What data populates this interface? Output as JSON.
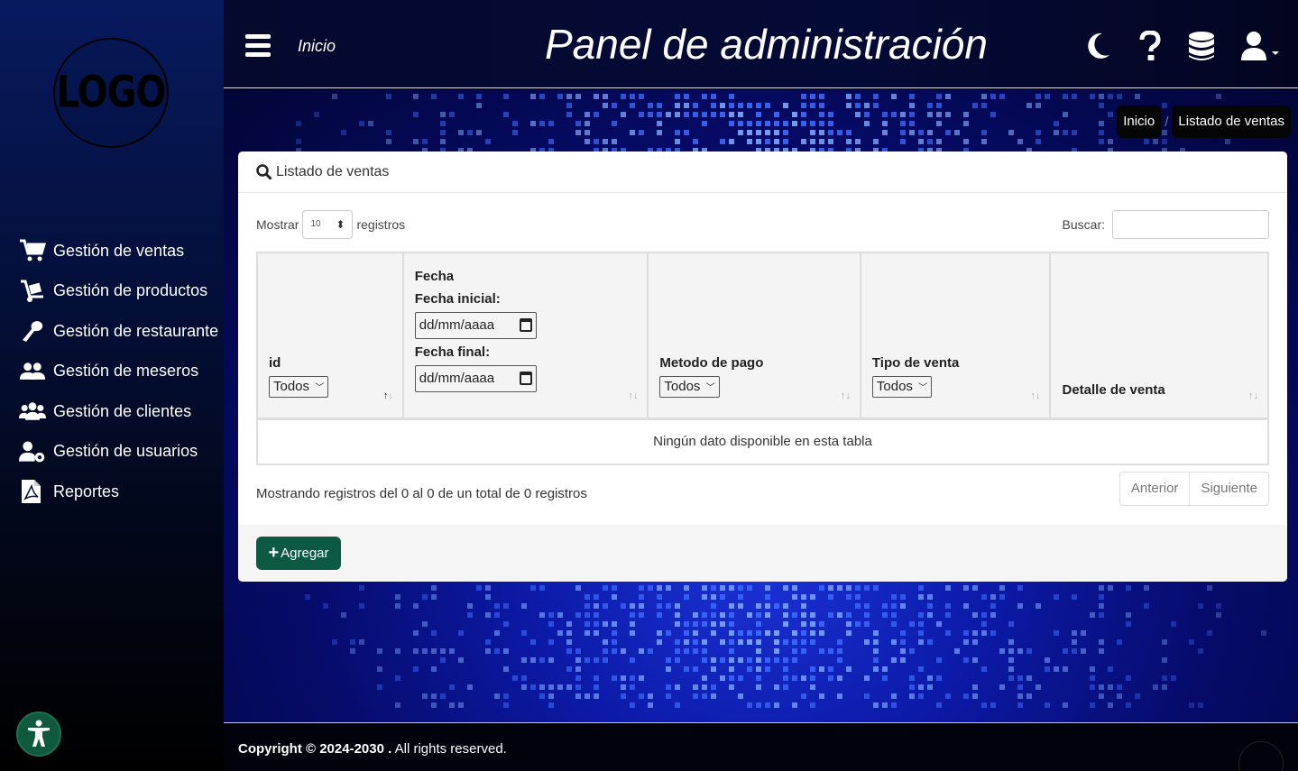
{
  "sidebar": {
    "logo_text": "LOGO",
    "items": [
      {
        "label": "Gestión de ventas",
        "icon": "cart-icon"
      },
      {
        "label": "Gestión de productos",
        "icon": "dolly-icon"
      },
      {
        "label": "Gestión de restaurante",
        "icon": "restaurant-icon"
      },
      {
        "label": "Gestión de meseros",
        "icon": "users-icon"
      },
      {
        "label": "Gestión de clientes",
        "icon": "users-group-icon"
      },
      {
        "label": "Gestión de usuarios",
        "icon": "user-gear-icon"
      },
      {
        "label": "Reportes",
        "icon": "pdf-file-icon"
      }
    ]
  },
  "header": {
    "home_link": "Inicio",
    "title": "Panel de administración",
    "icons": [
      "moon-icon",
      "question-icon",
      "database-icon",
      "user-icon"
    ]
  },
  "breadcrumb": {
    "home": "Inicio",
    "separator": "/",
    "current": "Listado de ventas"
  },
  "card": {
    "title": "Listado de ventas",
    "show_label": "Mostrar",
    "page_size": "10",
    "records_label": "registros",
    "search_label": "Buscar:",
    "search_value": "",
    "columns": {
      "id": {
        "label": "id",
        "filter": "Todos"
      },
      "fecha": {
        "label": "Fecha",
        "start_label": "Fecha inicial:",
        "start_placeholder": "dd/mm/aaaa",
        "end_label": "Fecha final:",
        "end_placeholder": "dd/mm/aaaa"
      },
      "metodo": {
        "label": "Metodo de pago",
        "filter": "Todos"
      },
      "tipo": {
        "label": "Tipo de venta",
        "filter": "Todos"
      },
      "detalle": {
        "label": "Detalle de venta"
      }
    },
    "empty_message": "Ningún dato disponible en esta tabla",
    "info": "Mostrando registros del 0 al 0 de un total de 0 registros",
    "pager": {
      "prev": "Anterior",
      "next": "Siguiente"
    },
    "add_button": "Agregar"
  },
  "footer": {
    "copyright_bold": "Copyright © 2024-2030 .",
    "copyright_rest": " All rights reserved."
  },
  "colors": {
    "accent_green": "#0c5a43",
    "sidebar_top": "#071a5e",
    "main_blue": "#0c1aa8"
  }
}
